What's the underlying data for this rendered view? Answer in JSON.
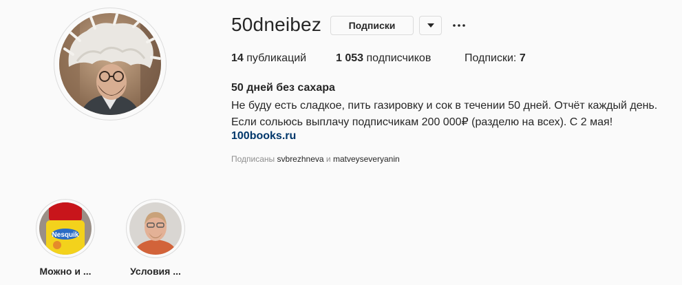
{
  "profile": {
    "username": "50dneibez",
    "following_button_label": "Подписки",
    "stats": {
      "posts_count": "14",
      "posts_label": "публикаций",
      "followers_count": "1 053",
      "followers_label": "подписчиков",
      "following_label": "Подписки:",
      "following_count": "7"
    },
    "bio": {
      "name": "50 дней без сахара",
      "text": "Не буду есть сладкое, пить газировку и сок в течении 50 дней. Отчёт каждый день. Если сольюсь выплачу подписчикам 200 000₽ (разделю на всех). С 2 мая!",
      "link": "100books.ru"
    },
    "followed_by": {
      "prefix": "Подписаны",
      "user1": "svbrezhneva",
      "conjunction": "и",
      "user2": "matveyseveryanin"
    }
  },
  "highlights": [
    {
      "label": "Можно и ..."
    },
    {
      "label": "Условия ..."
    }
  ],
  "icons": {
    "dropdown": "chevron-down-icon",
    "more": "more-options-icon"
  },
  "colors": {
    "background": "#fafafa",
    "text": "#262626",
    "muted": "#8e8e8e",
    "link": "#00376b",
    "border": "#dbdbdb"
  }
}
